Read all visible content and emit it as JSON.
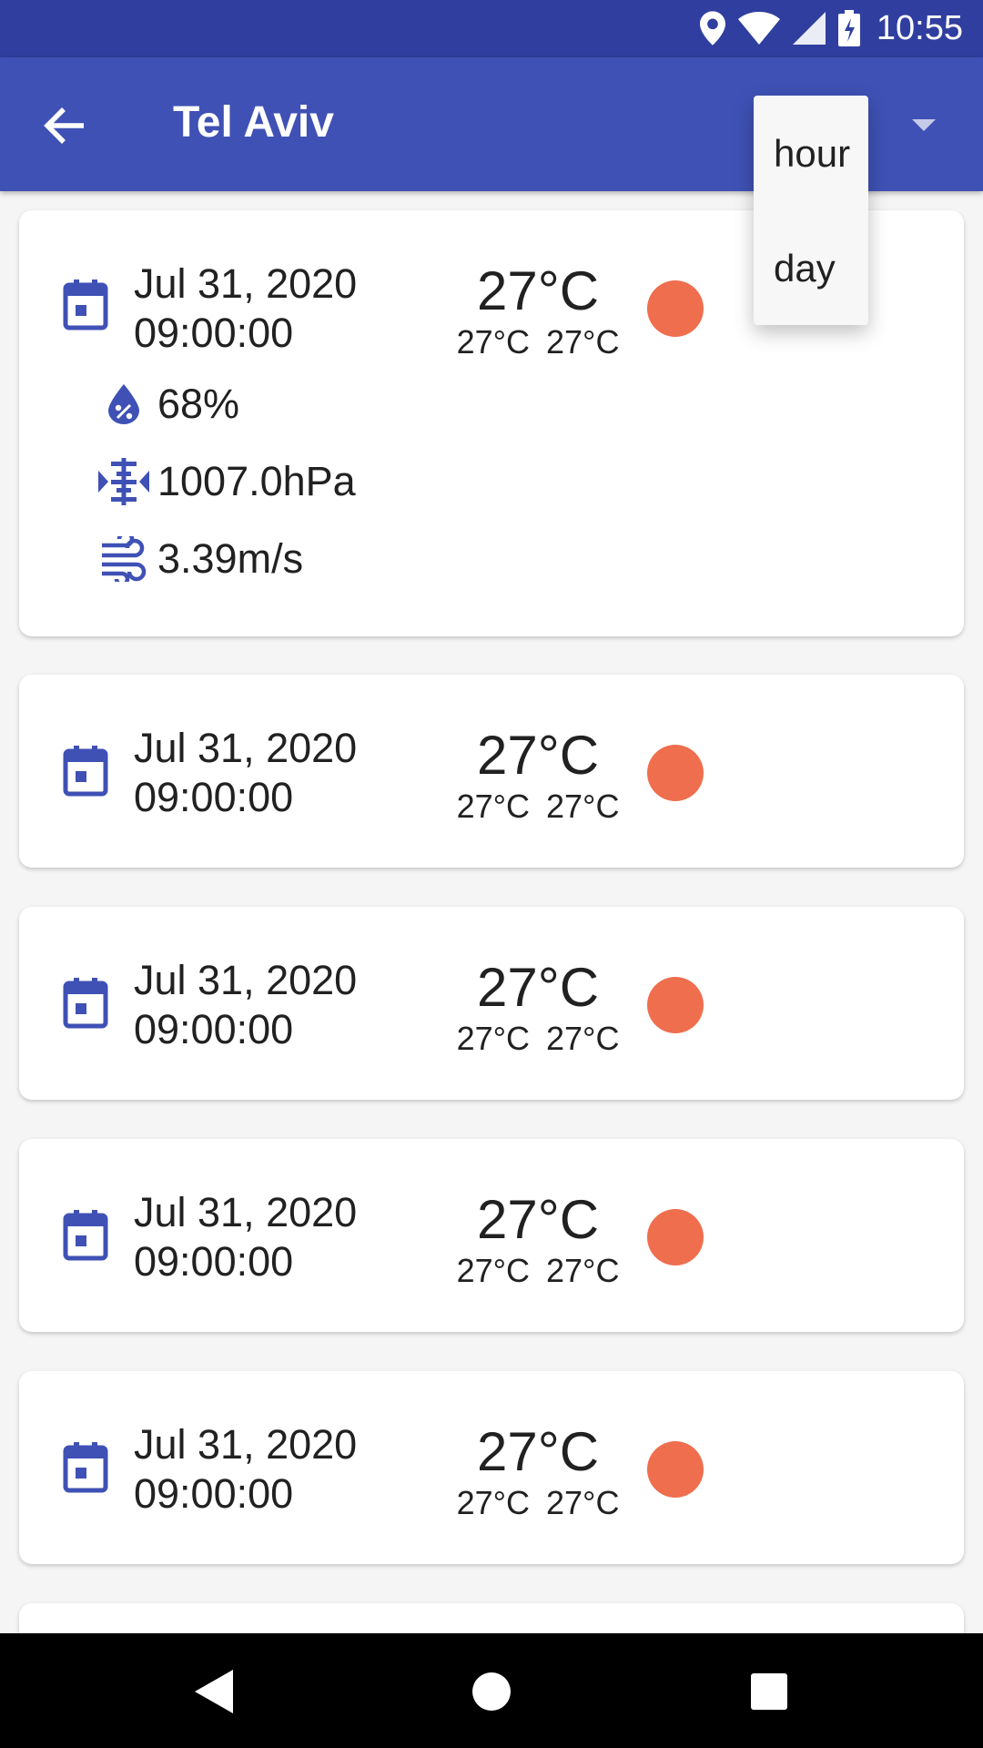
{
  "status_bar": {
    "time": "10:55",
    "icons": [
      "location-icon",
      "wifi-icon",
      "signal-icon",
      "battery-charging-icon"
    ]
  },
  "app_bar": {
    "title": "Tel Aviv",
    "back_icon": "arrow-back-icon",
    "menu_icon": "dropdown-arrow-icon"
  },
  "dropdown_menu": {
    "items": [
      "hour",
      "day"
    ]
  },
  "forecast": [
    {
      "date": "Jul 31, 2020",
      "time": "09:00:00",
      "temp": "27°C",
      "temp_min": "27°C",
      "temp_max": "27°C",
      "humidity": "68%",
      "pressure": "1007.0hPa",
      "wind": "3.39m/s"
    },
    {
      "date": "Jul 31, 2020",
      "time": "09:00:00",
      "temp": "27°C",
      "temp_min": "27°C",
      "temp_max": "27°C"
    },
    {
      "date": "Jul 31, 2020",
      "time": "09:00:00",
      "temp": "27°C",
      "temp_min": "27°C",
      "temp_max": "27°C"
    },
    {
      "date": "Jul 31, 2020",
      "time": "09:00:00",
      "temp": "27°C",
      "temp_min": "27°C",
      "temp_max": "27°C"
    },
    {
      "date": "Jul 31, 2020",
      "time": "09:00:00",
      "temp": "27°C",
      "temp_min": "27°C",
      "temp_max": "27°C"
    }
  ],
  "colors": {
    "primary": "#3f51b5",
    "primary_dark": "#303f9f",
    "weather_dot": "#ee6e4e"
  },
  "nav_bar": {
    "icons": [
      "back-triangle-icon",
      "home-circle-icon",
      "recents-square-icon"
    ]
  }
}
